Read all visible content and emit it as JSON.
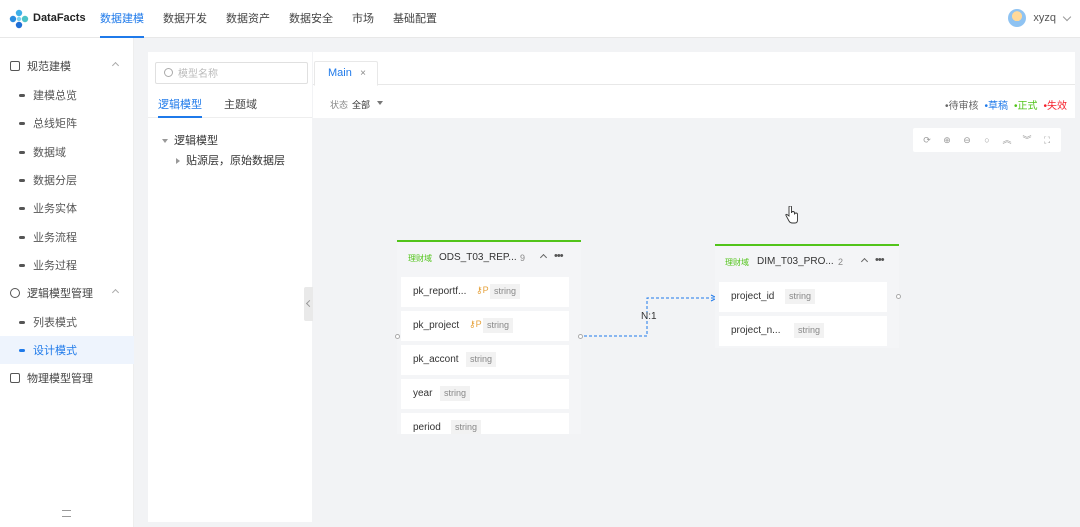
{
  "app": {
    "brand": "DataFacts"
  },
  "nav": {
    "items": [
      "数据建模",
      "数据开发",
      "数据资产",
      "数据安全",
      "市场",
      "基础配置"
    ],
    "active_index": 0
  },
  "user": {
    "name": "xyzq"
  },
  "sidebar": {
    "group1": "规范建模",
    "group1_items": [
      "建模总览",
      "总线矩阵",
      "数据域",
      "数据分层",
      "业务实体",
      "业务流程",
      "业务过程"
    ],
    "group2": "逻辑模型管理",
    "group2_items": [
      "列表模式",
      "设计模式"
    ],
    "group3": "物理模型管理",
    "active_item": "设计模式"
  },
  "tree": {
    "search_placeholder": "模型名称",
    "tabs": [
      "逻辑模型",
      "主题域"
    ],
    "root": "逻辑模型",
    "child": "贴源层，原始数据层"
  },
  "main_tab": {
    "label": "Main",
    "close": "×"
  },
  "filter": {
    "label": "状态",
    "value": "全部"
  },
  "legend": [
    {
      "label": "•待审核",
      "color": "#666666"
    },
    {
      "label": "•草稿",
      "color": "#1f7aea"
    },
    {
      "label": "•正式",
      "color": "#52c41a"
    },
    {
      "label": "•失效",
      "color": "#f5222d"
    }
  ],
  "zoom_icons": [
    "refresh-icon",
    "zoom-in-icon",
    "zoom-out-icon",
    "search-icon",
    "expand-up-icon",
    "collapse-down-icon",
    "fullscreen-icon"
  ],
  "entity1": {
    "tag": "理财域",
    "name": "ODS_T03_REP...",
    "count": "9",
    "fields": [
      {
        "name": "pk_reportf...",
        "key": "P",
        "type": "string"
      },
      {
        "name": "pk_project",
        "key": "P",
        "type": "string"
      },
      {
        "name": "pk_accont",
        "key": "",
        "type": "string"
      },
      {
        "name": "year",
        "key": "",
        "type": "string"
      },
      {
        "name": "period",
        "key": "",
        "type": "string"
      }
    ]
  },
  "entity2": {
    "tag": "理财域",
    "name": "DIM_T03_PRO...",
    "count": "2",
    "fields": [
      {
        "name": "project_id",
        "key": "",
        "type": "string"
      },
      {
        "name": "project_n...",
        "key": "",
        "type": "string"
      }
    ]
  },
  "relation": {
    "label": "N:1"
  },
  "colors": {
    "accent": "#1f7aea",
    "green": "#52c41a"
  }
}
